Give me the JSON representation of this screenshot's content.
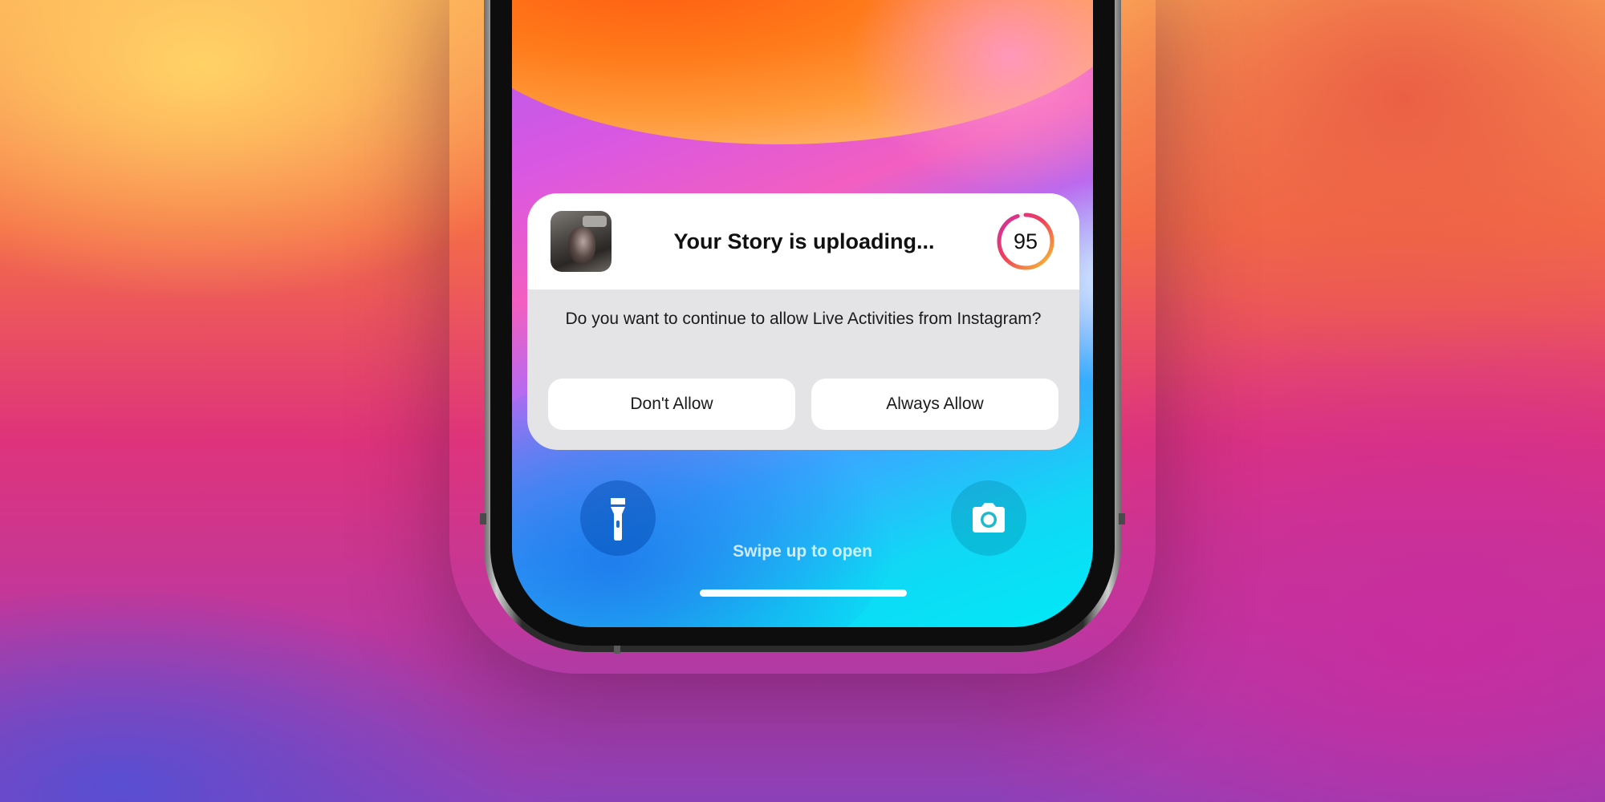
{
  "live_activity": {
    "title": "Your Story is uploading...",
    "progress_value": 95,
    "progress_label": "95",
    "prompt": "Do you want to continue to allow Live Activities from Instagram?",
    "buttons": {
      "deny_label": "Don't Allow",
      "allow_label": "Always Allow"
    },
    "thumbnail_icon": "story-thumbnail-photo",
    "ring_colors": [
      "#f7c52f",
      "#ee3f5a",
      "#d12ea2"
    ]
  },
  "lock_screen": {
    "flashlight_icon": "flashlight-icon",
    "camera_icon": "camera-icon",
    "swipe_hint": "Swipe up to open"
  }
}
